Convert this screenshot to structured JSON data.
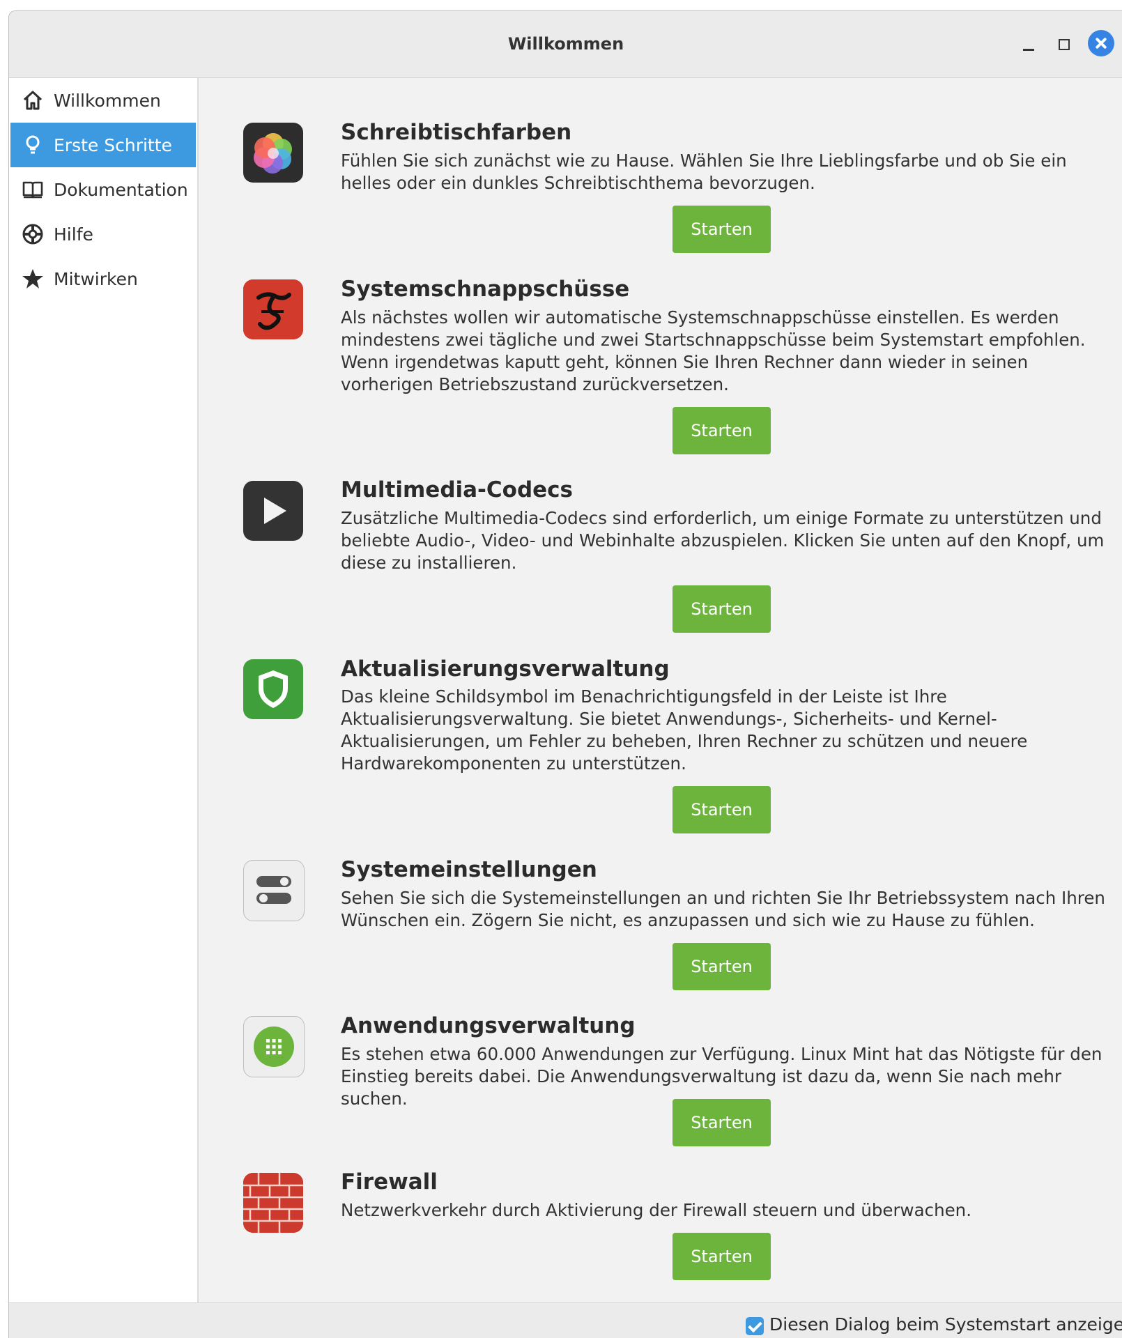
{
  "window": {
    "title": "Willkommen"
  },
  "sidebar": {
    "items": [
      {
        "label": "Willkommen",
        "icon": "home-icon",
        "active": false
      },
      {
        "label": "Erste Schritte",
        "icon": "lightbulb-icon",
        "active": true
      },
      {
        "label": "Dokumentation",
        "icon": "book-icon",
        "active": false
      },
      {
        "label": "Hilfe",
        "icon": "lifebuoy-icon",
        "active": false
      },
      {
        "label": "Mitwirken",
        "icon": "star-icon",
        "active": false
      }
    ]
  },
  "sections": [
    {
      "title": "Schreibtischfarben",
      "description": "Fühlen Sie sich zunächst wie zu Hause. Wählen Sie Ihre Lieblingsfarbe und ob Sie ein helles oder ein dunkles Schreibtischthema bevorzugen.",
      "button": "Starten",
      "icon": "color-flower-icon"
    },
    {
      "title": "Systemschnappschüsse",
      "description": "Als nächstes wollen wir automatische Systemschnappschüsse einstellen. Es werden mindestens zwei tägliche und zwei Startschnappschüsse beim Systemstart empfohlen. Wenn irgendetwas kaputt geht, können Sie Ihren Rechner dann wieder in seinen vorherigen Betriebszustand zurückversetzen.",
      "button": "Starten",
      "icon": "timeshift-icon"
    },
    {
      "title": "Multimedia-Codecs",
      "description": "Zusätzliche Multimedia-Codecs sind erforderlich, um einige Formate zu unterstützen und beliebte Audio-, Video- und Webinhalte abzuspielen. Klicken Sie unten auf den Knopf, um diese zu installieren.",
      "button": "Starten",
      "icon": "play-icon"
    },
    {
      "title": "Aktualisierungsverwaltung",
      "description": "Das kleine Schildsymbol im Benachrichtigungsfeld in der Leiste ist Ihre Aktualisierungsverwaltung. Sie bietet Anwendungs-, Sicherheits- und Kernel-Aktualisierungen, um Fehler zu beheben, Ihren Rechner zu schützen und neuere Hardwarekomponenten zu unterstützen.",
      "button": "Starten",
      "icon": "shield-icon"
    },
    {
      "title": "Systemeinstellungen",
      "description": "Sehen Sie sich die Systemeinstellungen an und richten Sie Ihr Betriebssystem nach Ihren Wünschen ein. Zögern Sie nicht, es anzupassen und sich wie zu Hause zu fühlen.",
      "button": "Starten",
      "icon": "toggles-icon"
    },
    {
      "title": "Anwendungsverwaltung",
      "description": "Es stehen etwa 60.000 Anwendungen zur Verfügung. Linux Mint hat das Nötigste für den Einstieg bereits dabei. Die Anwendungsverwaltung ist dazu da, wenn Sie nach mehr suchen.",
      "button": "Starten",
      "icon": "app-grid-icon"
    },
    {
      "title": "Firewall",
      "description": "Netzwerkverkehr durch Aktivierung der Firewall steuern und überwachen.",
      "button": "Starten",
      "icon": "brick-wall-icon"
    }
  ],
  "footer": {
    "checkbox_label": "Diesen Dialog beim Systemstart anzeigen",
    "checked": true
  },
  "colors": {
    "accent": "#3d9ae0",
    "button": "#6cb43c",
    "close": "#3584e4"
  }
}
